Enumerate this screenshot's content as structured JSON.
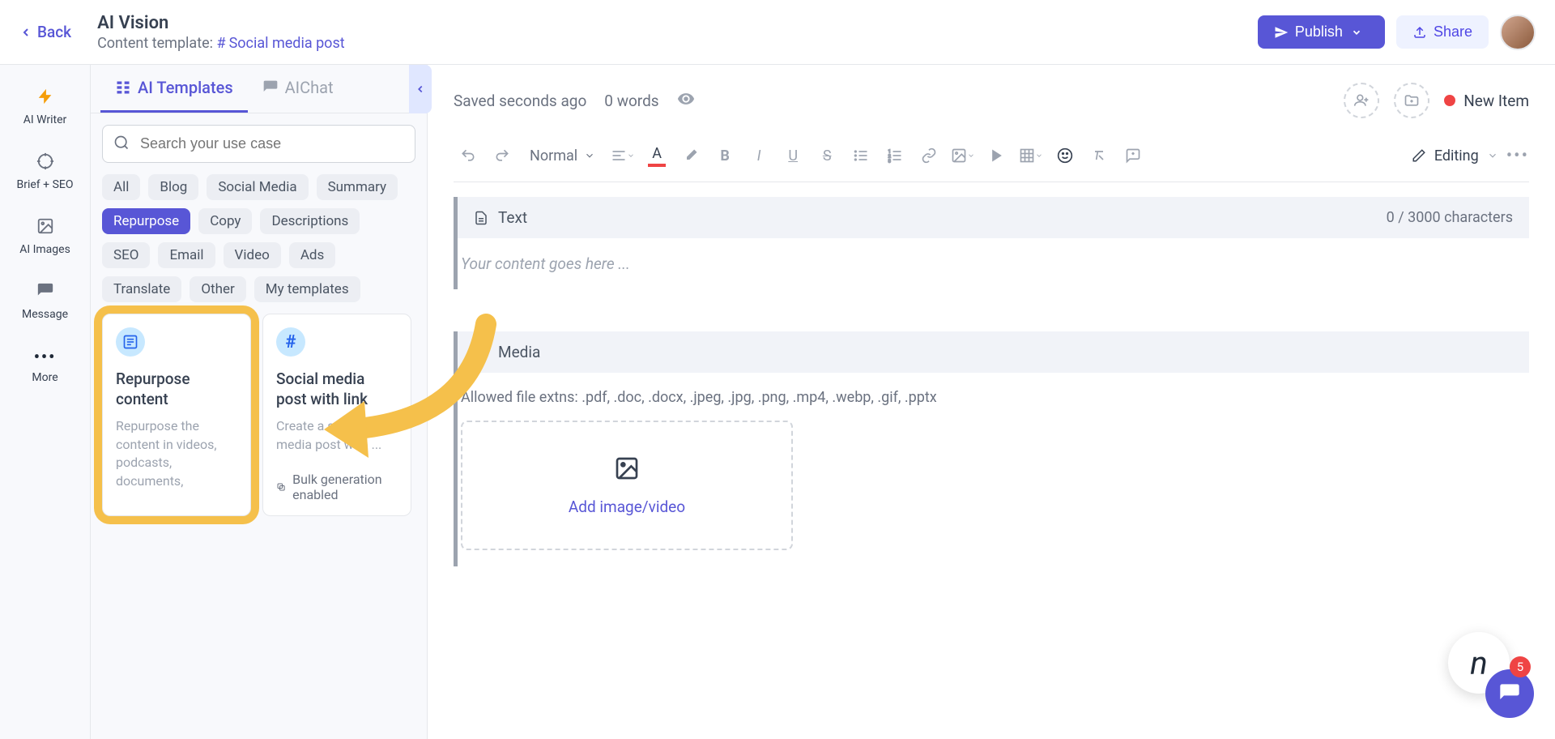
{
  "header": {
    "back": "Back",
    "title": "AI Vision",
    "subtitle_label": "Content template:",
    "subtitle_link": "Social media post",
    "publish": "Publish",
    "share": "Share"
  },
  "rail": {
    "items": [
      {
        "label": "AI Writer",
        "icon": "bolt"
      },
      {
        "label": "Brief + SEO",
        "icon": "target"
      },
      {
        "label": "AI Images",
        "icon": "image"
      },
      {
        "label": "Message",
        "icon": "chat"
      },
      {
        "label": "More",
        "icon": "dots"
      }
    ]
  },
  "sidepanel": {
    "tabs": [
      {
        "label": "AI Templates"
      },
      {
        "label": "AIChat"
      }
    ],
    "search_placeholder": "Search your use case",
    "chips": [
      "All",
      "Blog",
      "Social Media",
      "Summary",
      "Repurpose",
      "Copy",
      "Descriptions",
      "SEO",
      "Email",
      "Video",
      "Ads",
      "Translate",
      "Other",
      "My templates"
    ],
    "active_chip": "Repurpose",
    "cards": [
      {
        "title": "Repurpose content",
        "desc": "Repurpose the content in videos, podcasts, documents,"
      },
      {
        "title": "Social media post with link",
        "desc": "Create a social media post with ...",
        "footer": "Bulk generation enabled"
      }
    ]
  },
  "editor": {
    "saved": "Saved seconds ago",
    "words": "0 words",
    "new_item": "New Item",
    "paragraph_style": "Normal",
    "editing_label": "Editing",
    "text_block": {
      "label": "Text",
      "count": "0 / 3000 characters",
      "placeholder": "Your content goes here ..."
    },
    "media_block": {
      "label": "Media",
      "hint": "Allowed file extns: .pdf, .doc, .docx, .jpeg, .jpg, .png, .mp4, .webp, .gif, .pptx",
      "drop_label": "Add image/video"
    }
  },
  "floating": {
    "badge": "5",
    "n": "n"
  }
}
